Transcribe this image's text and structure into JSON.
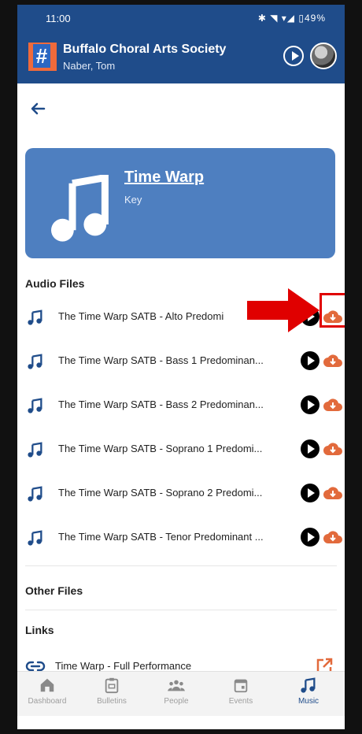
{
  "status": {
    "time": "11:00",
    "right": "✱ ◥ ▾◢ ▯49%"
  },
  "app": {
    "title": "Buffalo Choral Arts Society",
    "user": "Naber, Tom"
  },
  "hero": {
    "title": "Time Warp",
    "subtitle": "Key"
  },
  "sections": {
    "audio": "Audio Files",
    "other": "Other Files",
    "links": "Links"
  },
  "audio_files": [
    {
      "label": "The Time Warp SATB - Alto Predomi"
    },
    {
      "label": "The Time Warp SATB - Bass 1 Predominan..."
    },
    {
      "label": "The Time Warp SATB - Bass 2 Predominan..."
    },
    {
      "label": "The Time Warp SATB - Soprano 1 Predomi..."
    },
    {
      "label": "The Time Warp SATB - Soprano 2 Predomi..."
    },
    {
      "label": "The Time Warp SATB - Tenor Predominant ..."
    }
  ],
  "link": {
    "label": "Time Warp - Full Performance"
  },
  "nav": [
    "Dashboard",
    "Bulletins",
    "People",
    "Events",
    "Music"
  ],
  "colors": {
    "primary": "#1f4c8a",
    "hero": "#4e7fc0",
    "download": "#e26a3c",
    "highlight": "#e00000"
  },
  "icons": {
    "note": "music-note-icon",
    "play": "play-icon",
    "download": "cloud-download-icon",
    "link": "link-icon",
    "external": "external-link-icon"
  }
}
